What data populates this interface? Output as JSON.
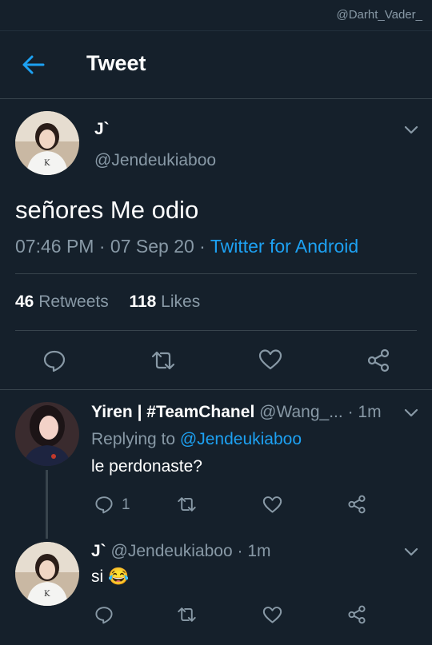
{
  "watermark": "@Darht_Vader_",
  "header": {
    "title": "Tweet"
  },
  "main_tweet": {
    "display_name": "J`",
    "handle": "@Jendeukiaboo",
    "text": "señores Me odio",
    "time": "07:46 PM",
    "sep1": "·",
    "date": "07 Sep 20",
    "sep2": "·",
    "source": "Twitter for Android",
    "retweets_count": "46",
    "retweets_label": "Retweets",
    "likes_count": "118",
    "likes_label": "Likes"
  },
  "replies": [
    {
      "display_name": "Yiren | #TeamChanel",
      "handle": "@Wang_...",
      "sep": "·",
      "time": "1m",
      "replying_to_label": "Replying to",
      "replying_to_handle": "@Jendeukiaboo",
      "text": "le perdonaste?",
      "reply_count": "1"
    },
    {
      "display_name": "J`",
      "handle": "@Jendeukiaboo",
      "sep": "·",
      "time": "1m",
      "text": "si",
      "emoji": "😂"
    }
  ],
  "colors": {
    "background": "#15202b",
    "accent": "#1da1f2",
    "muted": "#8899a6",
    "divider": "#38444d"
  },
  "icons": [
    "back-arrow-icon",
    "chevron-down-icon",
    "reply-icon",
    "retweet-icon",
    "like-icon",
    "share-icon"
  ]
}
